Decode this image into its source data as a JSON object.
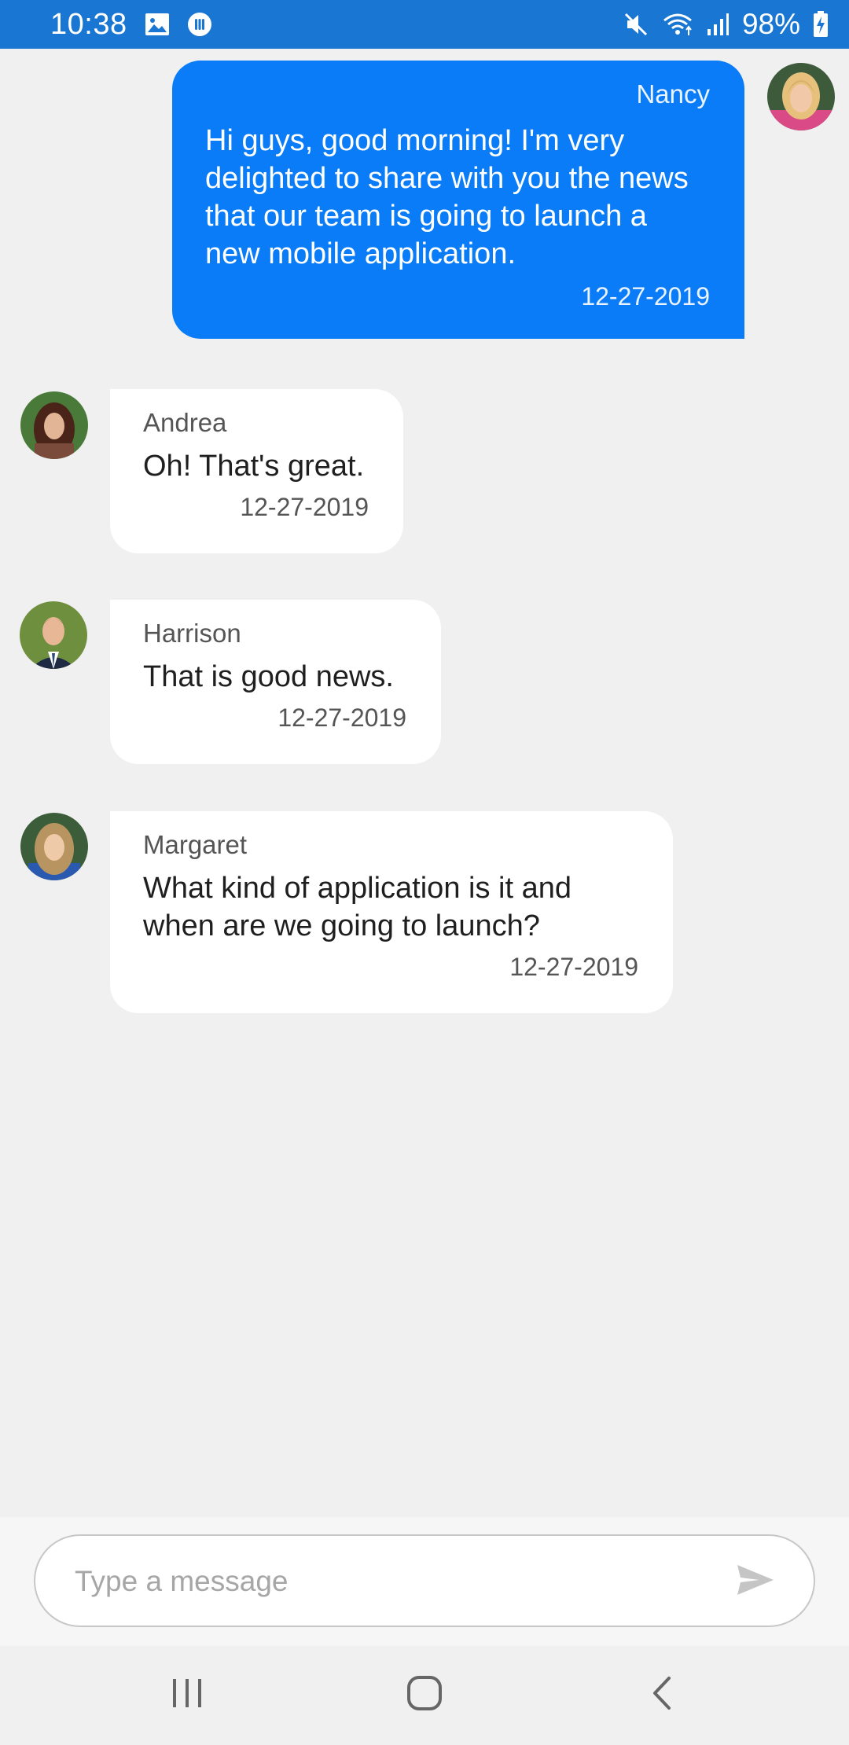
{
  "status_bar": {
    "time": "10:38",
    "battery": "98%",
    "icons": [
      "gallery-icon",
      "app-notification-icon",
      "mute-icon",
      "wifi-icon",
      "signal-icon",
      "battery-charging-icon"
    ]
  },
  "messages": [
    {
      "author": "Nancy",
      "text": "Hi guys, good morning! I'm very delighted to share with you the news that our team is going to launch a new mobile application.",
      "date": "12-27-2019",
      "outgoing": true,
      "avatar": "avatar-nancy"
    },
    {
      "author": "Andrea",
      "text": "Oh! That's great.",
      "date": "12-27-2019",
      "outgoing": false,
      "avatar": "avatar-andrea"
    },
    {
      "author": "Harrison",
      "text": "That is good news.",
      "date": "12-27-2019",
      "outgoing": false,
      "avatar": "avatar-harrison"
    },
    {
      "author": "Margaret",
      "text": "What kind of application is it and when are we going to launch?",
      "date": "12-27-2019",
      "outgoing": false,
      "avatar": "avatar-margaret"
    }
  ],
  "composer": {
    "placeholder": "Type a message",
    "value": "",
    "send_icon": "send-icon"
  },
  "nav_bar": {
    "icons": [
      "recent-apps-icon",
      "home-icon",
      "back-icon"
    ]
  },
  "colors": {
    "status_bar": "#1976d2",
    "outgoing_bubble": "#0a7cf7",
    "incoming_bubble": "#ffffff",
    "background": "#f0f0f0"
  }
}
